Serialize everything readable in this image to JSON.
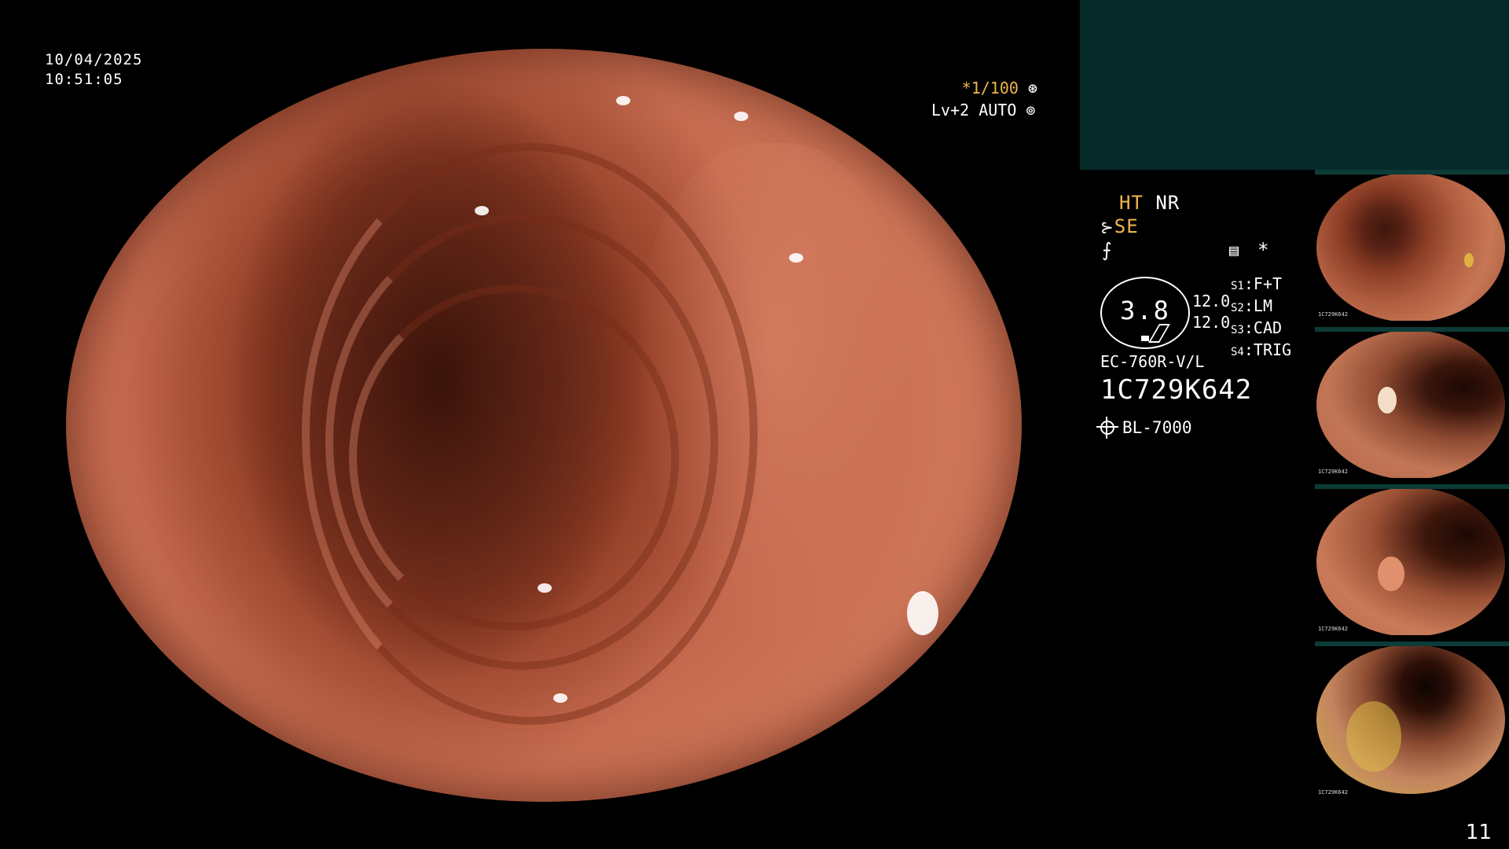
{
  "datetime": {
    "date": "10/04/2025",
    "time": "10:51:05"
  },
  "imaging": {
    "shutter": "*1/100",
    "shutter_icon": "aperture-icon",
    "level_auto": "Lv+2 AUTO",
    "level_icon": "iris-icon"
  },
  "modes": {
    "ht": "HT",
    "nr": "NR",
    "se": "SE",
    "se_icon": "tool-icon",
    "freeze_icon": "freeze-icon",
    "memo_icon": "card-icon",
    "asterisk": "*"
  },
  "zoom": {
    "value": "3.8",
    "upper": "12.0",
    "lower": "12.0"
  },
  "switches": [
    {
      "key": "S1",
      "value": "F+T"
    },
    {
      "key": "S2",
      "value": "LM"
    },
    {
      "key": "S3",
      "value": "CAD"
    },
    {
      "key": "S4",
      "value": "TRIG"
    }
  ],
  "scope": {
    "model": "EC-760R-V/L",
    "serial": "1C729K642"
  },
  "light_source": {
    "icon": "light-icon",
    "name": "BL-7000"
  },
  "thumbnail_scope": "1C729K642",
  "page_number": "11",
  "colors": {
    "accent_yellow": "#f0b84a",
    "panel_teal": "#062a27",
    "mucosa": "#c0644a"
  }
}
